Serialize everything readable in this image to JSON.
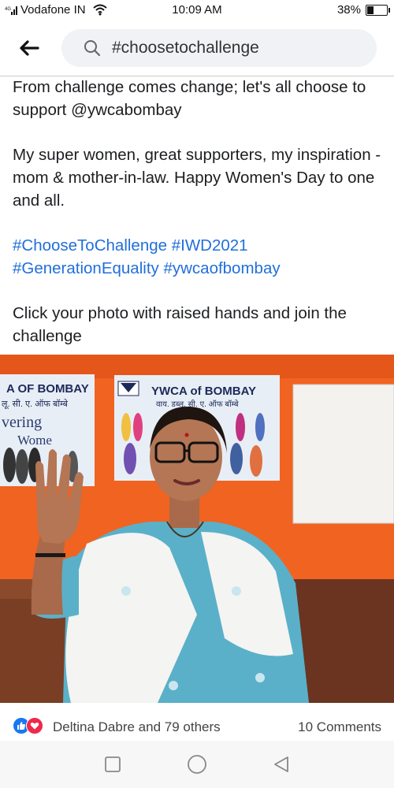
{
  "status_bar": {
    "carrier": "Vodafone IN",
    "network": "4G",
    "time": "10:09 AM",
    "battery": "38%",
    "battery_level": 0.38
  },
  "search": {
    "query": "#choosetochallenge"
  },
  "post": {
    "paragraphs": [
      "From challenge comes change; let's all choose to support @ywcabombay",
      "My super women, great supporters, my inspiration - mom & mother-in-law. Happy Women's Day to one and all.",
      "#ChooseToChallenge #IWD2021 #GenerationEquality #ywcaofbombay",
      "Click your photo with raised hands and join the challenge"
    ]
  },
  "photo": {
    "banner_left_text": "A OF BOMBAY",
    "banner_left_sub": "लू. सी. ए. ऑफ बॉम्बे",
    "banner_left_word1": "vering",
    "banner_left_word2": "Wome",
    "banner_right_logo": "YWCA",
    "banner_right_text": "YWCA of BOMBAY",
    "banner_right_sub": "वाय. डब्लू. सी. ए. ऑफ बॉम्बे"
  },
  "reactions": {
    "names": "Deltina Dabre and 79 others",
    "comments": "10 Comments"
  },
  "colors": {
    "link": "#216fdb",
    "like": "#1877f2",
    "love": "#f0284a",
    "wall": "#f16321"
  }
}
